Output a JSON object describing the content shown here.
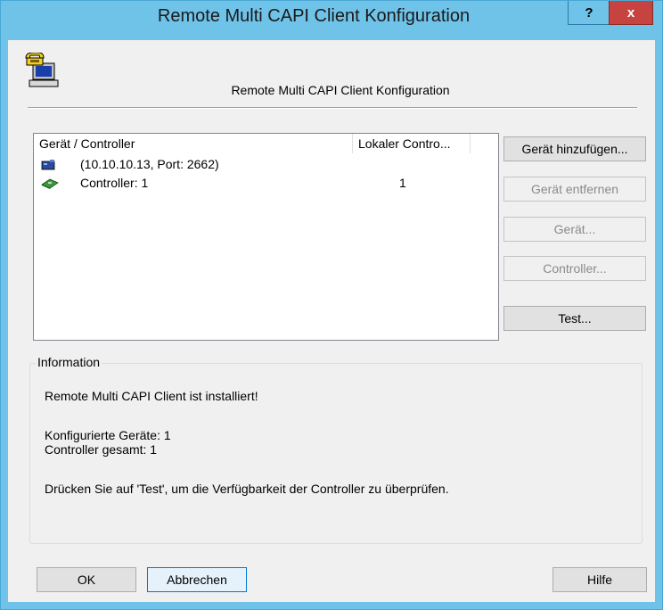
{
  "window": {
    "title": "Remote Multi CAPI Client Konfiguration",
    "help_label": "?",
    "close_label": "x"
  },
  "header": {
    "title": "Remote Multi CAPI Client Konfiguration",
    "icon": "telephone-computer-icon"
  },
  "list": {
    "columns": [
      "Gerät / Controller",
      "Lokaler Contro..."
    ],
    "rows": [
      {
        "icon": "network-device-icon",
        "name": "(10.10.10.13, Port: 2662)",
        "local": ""
      },
      {
        "icon": "controller-card-icon",
        "name": "Controller: 1",
        "local": "1"
      }
    ]
  },
  "side_buttons": {
    "add_device": "Gerät hinzufügen...",
    "remove_device": "Gerät entfernen",
    "device": "Gerät...",
    "controller": "Controller...",
    "test": "Test..."
  },
  "info": {
    "label": "Information",
    "installed": "Remote Multi CAPI Client ist installiert!",
    "configured_devices": "Konfigurierte Geräte: 1",
    "controller_total": "Controller gesamt: 1",
    "hint": "Drücken Sie auf 'Test', um die Verfügbarkeit der Controller zu überprüfen."
  },
  "footer": {
    "ok": "OK",
    "cancel": "Abbrechen",
    "help": "Hilfe"
  },
  "colors": {
    "title_bar": "#6fc3e8",
    "close_button": "#c7433f",
    "dialog_bg": "#f0f0f0",
    "default_button_border": "#0078d7"
  }
}
